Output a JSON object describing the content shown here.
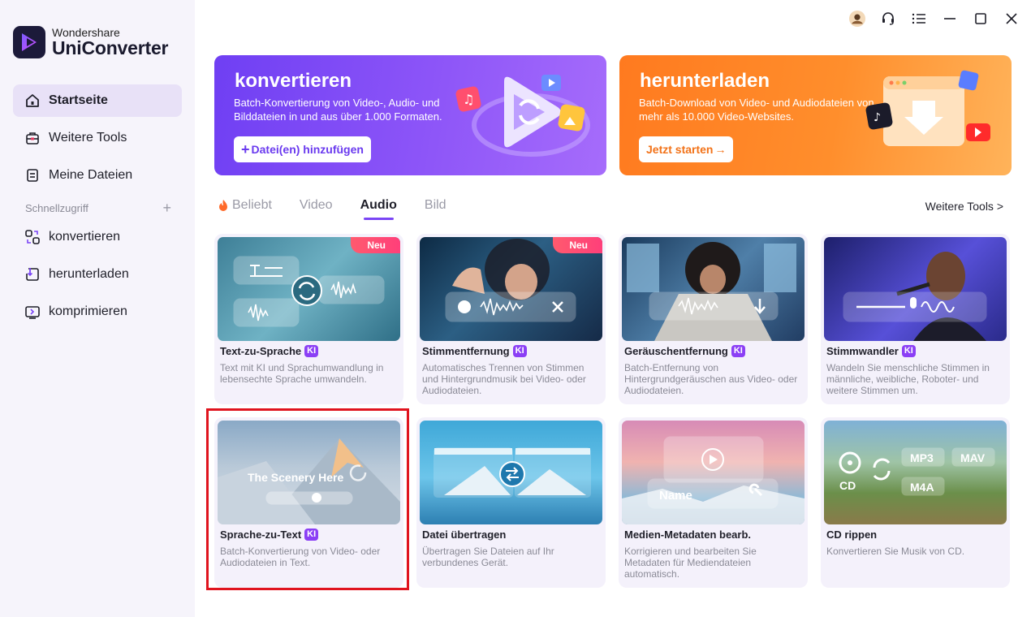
{
  "app": {
    "brand_top": "Wondershare",
    "brand_name": "UniConverter"
  },
  "sidebar": {
    "items": [
      {
        "label": "Startseite",
        "icon": "home-icon",
        "active": true
      },
      {
        "label": "Weitere Tools",
        "icon": "toolbox-icon"
      },
      {
        "label": "Meine Dateien",
        "icon": "file-icon"
      }
    ],
    "quick_access_label": "Schnellzugriff",
    "quick_items": [
      {
        "label": "konvertieren",
        "icon": "convert-icon"
      },
      {
        "label": "herunterladen",
        "icon": "download-icon"
      },
      {
        "label": "komprimieren",
        "icon": "compress-icon"
      }
    ]
  },
  "titlebar": {
    "icons": [
      "avatar",
      "headset-icon",
      "menu-icon",
      "minimize-icon",
      "maximize-icon",
      "close-icon"
    ]
  },
  "banners": {
    "convert": {
      "title": "konvertieren",
      "text": "Batch-Konvertierung von Video-, Audio- und Bilddateien in und aus über 1.000 Formaten.",
      "button": "Datei(en) hinzufügen",
      "button_icon": "+"
    },
    "download": {
      "title": "herunterladen",
      "text": "Batch-Download von Video- und Audiodateien von mehr als 10.000 Video-Websites.",
      "button": "Jetzt starten",
      "button_icon": "→"
    }
  },
  "tabs": [
    {
      "label": "Beliebt",
      "icon": "fire-icon"
    },
    {
      "label": "Video"
    },
    {
      "label": "Audio",
      "active": true
    },
    {
      "label": "Bild"
    }
  ],
  "more_tools": "Weitere Tools >",
  "badges": {
    "new": "Neu",
    "ki": "KI"
  },
  "cards": [
    {
      "title": "Text-zu-Sprache",
      "ki": true,
      "new": true,
      "desc": "Text mit KI und Sprachumwandlung in lebensechte Sprache umwandeln."
    },
    {
      "title": "Stimmentfernung",
      "ki": true,
      "new": true,
      "desc": "Automatisches Trennen von Stimmen und Hintergrundmusik bei Video- oder Audiodateien."
    },
    {
      "title": "Geräuschentfernung",
      "ki": true,
      "desc": "Batch-Entfernung von Hintergrundgeräuschen aus Video- oder Audiodateien."
    },
    {
      "title": "Stimmwandler",
      "ki": true,
      "desc": "Wandeln Sie menschliche Stimmen in männliche, weibliche, Roboter- und weitere Stimmen um."
    },
    {
      "title": "Sprache-zu-Text",
      "ki": true,
      "desc": "Batch-Konvertierung von Video- oder Audiodateien in Text.",
      "thumb_text": "The Scenery Here"
    },
    {
      "title": "Datei übertragen",
      "desc": "Übertragen Sie Dateien auf Ihr verbundenes Gerät."
    },
    {
      "title": "Medien-Metadaten bearb.",
      "desc": "Korrigieren und bearbeiten Sie Metadaten für Mediendateien automatisch.",
      "thumb_text": "Name"
    },
    {
      "title": "CD rippen",
      "desc": "Konvertieren Sie Musik von CD.",
      "thumb_labels": [
        "CD",
        "MP3",
        "MAV",
        "M4A"
      ]
    }
  ],
  "colors": {
    "accent": "#7a45f5",
    "ki_badge": "#8b3ff5",
    "new_badge": "#ff4a72",
    "convert_banner": "#7c48f6",
    "download_banner": "#ff8a2a",
    "highlight": "#e0141e"
  }
}
